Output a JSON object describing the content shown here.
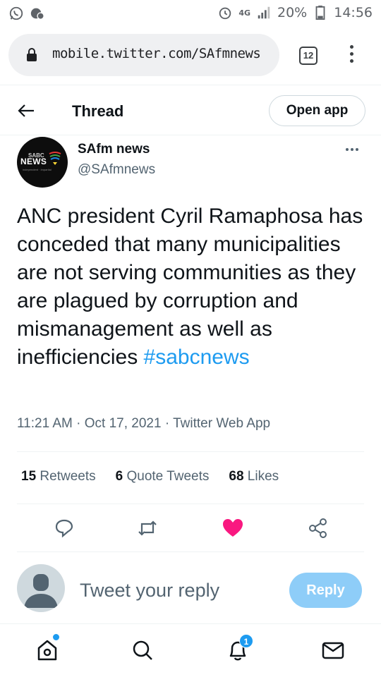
{
  "status_bar": {
    "network": "4G",
    "battery": "20%",
    "time": "14:56",
    "icons": [
      "whatsapp-icon",
      "notification-icon",
      "alarm-icon",
      "signal-icon",
      "battery-icon"
    ]
  },
  "browser": {
    "url": "mobile.twitter.com/SAfmnews",
    "tab_count": "12",
    "icons": [
      "lock-icon",
      "menu-dots-icon"
    ]
  },
  "header": {
    "title": "Thread",
    "open_app_label": "Open app",
    "icons": [
      "back-arrow-icon"
    ]
  },
  "tweet": {
    "avatar": {
      "logo_top": "SABC",
      "logo_main": "NEWS",
      "logo_sub": "independent · impartial"
    },
    "author_name": "SAfm news",
    "author_handle": "@SAfmnews",
    "text": "ANC president Cyril Ramaphosa has conceded that many municipalities are not serving communities as they are plagued by corruption and mismanagement as well as inefficiencies ",
    "hashtag": "#sabcnews",
    "meta": "11:21 AM · Oct 17, 2021 · Twitter Web App",
    "stats": {
      "retweets_count": "15",
      "retweets_label": "Retweets",
      "quotes_count": "6",
      "quotes_label": "Quote Tweets",
      "likes_count": "68",
      "likes_label": "Likes"
    },
    "actions": [
      "reply-icon",
      "retweet-icon",
      "like-icon",
      "share-icon"
    ],
    "liked": true,
    "like_color": "#f91880"
  },
  "reply_box": {
    "placeholder": "Tweet your reply",
    "button_label": "Reply"
  },
  "bottom_nav": {
    "items": [
      "home-icon",
      "search-icon",
      "notifications-icon",
      "messages-icon"
    ],
    "notifications_count": "1"
  },
  "colors": {
    "accent": "#1d9bf0",
    "reply_button": "#8ecdf8",
    "text_primary": "#0f1419",
    "text_secondary": "#536471"
  }
}
